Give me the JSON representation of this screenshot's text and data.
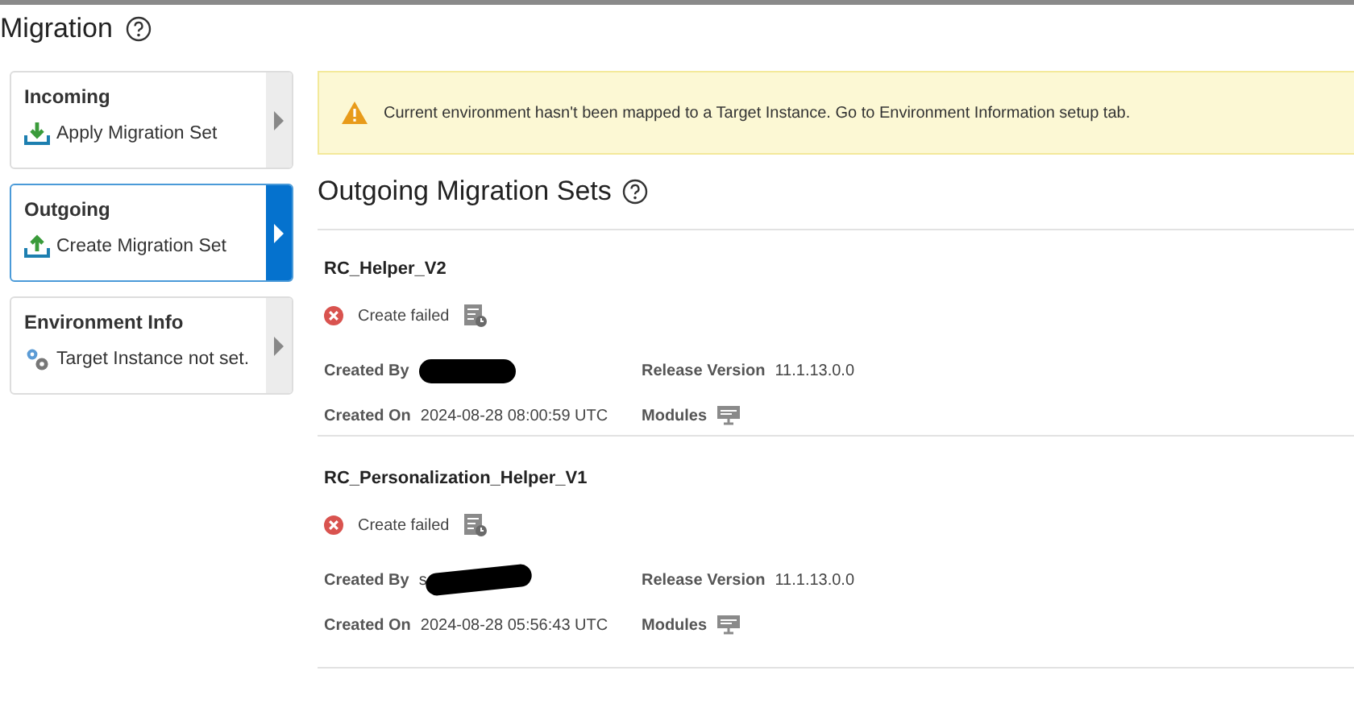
{
  "page": {
    "title": "Migration"
  },
  "sidebar": {
    "items": [
      {
        "label": "Incoming",
        "action": "Apply Migration Set",
        "kind": "download",
        "selected": false
      },
      {
        "label": "Outgoing",
        "action": "Create Migration Set",
        "kind": "upload",
        "selected": true
      },
      {
        "label": "Environment Info",
        "action": "Target Instance not set.",
        "kind": "gears",
        "selected": false
      }
    ]
  },
  "warning": {
    "message": "Current environment hasn't been mapped to a Target Instance. Go to Environment Information setup tab."
  },
  "section": {
    "title": "Outgoing Migration Sets"
  },
  "sets": [
    {
      "name": "RC_Helper_V2",
      "status": "Create failed",
      "kind": "error",
      "created_by_label": "Created By",
      "redacted": true,
      "created_on_label": "Created On",
      "created_on": "2024-08-28 08:00:59 UTC",
      "release_label": "Release Version",
      "release": "11.1.13.0.0",
      "modules_label": "Modules"
    },
    {
      "name": "RC_Personalization_Helper_V1",
      "status": "Create failed",
      "kind": "error",
      "created_by_label": "Created By",
      "created_by": "s",
      "redacted": true,
      "created_on_label": "Created On",
      "created_on": "2024-08-28 05:56:43 UTC",
      "release_label": "Release Version",
      "release": "11.1.13.0.0",
      "modules_label": "Modules"
    }
  ]
}
